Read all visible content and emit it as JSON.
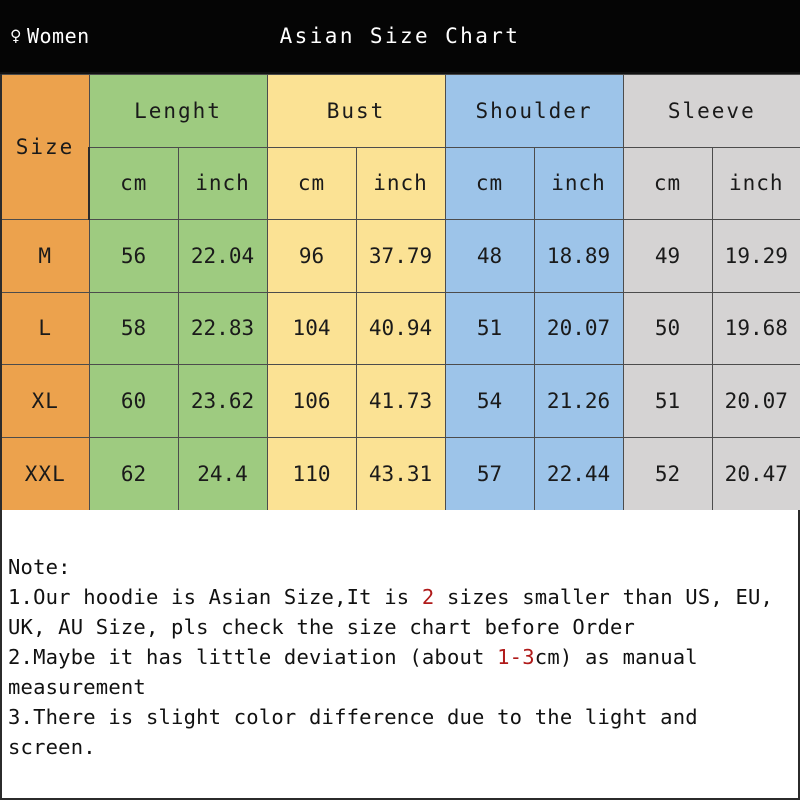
{
  "header": {
    "gender_icon": "venus-icon",
    "gender_symbol": "♀",
    "gender_label": "Women",
    "title": "Asian Size Chart"
  },
  "table": {
    "size_header": "Size",
    "groups": [
      {
        "label": "Lenght",
        "color": "#9ECB80"
      },
      {
        "label": "Bust",
        "color": "#FBE294"
      },
      {
        "label": "Shoulder",
        "color": "#9DC4E9"
      },
      {
        "label": "Sleeve",
        "color": "#D5D3D3"
      }
    ],
    "subheaders": {
      "cm": "cm",
      "inch": "inch"
    },
    "rows": [
      {
        "size": "M",
        "length_cm": "56",
        "length_inch": "22.04",
        "bust_cm": "96",
        "bust_inch": "37.79",
        "shoulder_cm": "48",
        "shoulder_inch": "18.89",
        "sleeve_cm": "49",
        "sleeve_inch": "19.29"
      },
      {
        "size": "L",
        "length_cm": "58",
        "length_inch": "22.83",
        "bust_cm": "104",
        "bust_inch": "40.94",
        "shoulder_cm": "51",
        "shoulder_inch": "20.07",
        "sleeve_cm": "50",
        "sleeve_inch": "19.68"
      },
      {
        "size": "XL",
        "length_cm": "60",
        "length_inch": "23.62",
        "bust_cm": "106",
        "bust_inch": "41.73",
        "shoulder_cm": "54",
        "shoulder_inch": "21.26",
        "sleeve_cm": "51",
        "sleeve_inch": "20.07"
      },
      {
        "size": "XXL",
        "length_cm": "62",
        "length_inch": "24.4",
        "bust_cm": "110",
        "bust_inch": "43.31",
        "shoulder_cm": "57",
        "shoulder_inch": "22.44",
        "sleeve_cm": "52",
        "sleeve_inch": "20.47"
      }
    ]
  },
  "notes": {
    "heading": "Note:",
    "line1_a": "1.Our hoodie is Asian Size,It is ",
    "line1_hl": "2",
    "line1_b": " sizes smaller than US, EU,",
    "line2": "UK, AU Size, pls check the size chart before Order",
    "line3_a": "2.Maybe it has little deviation (about ",
    "line3_hl": "1-3",
    "line3_b": "cm) as manual",
    "line4": "measurement",
    "line5": "3.There is slight color difference due to the light and screen."
  },
  "colors": {
    "size_column": "#ECA24D",
    "length_column": "#9ECB80",
    "bust_column": "#FBE294",
    "shoulder_column": "#9DC4E9",
    "sleeve_column": "#D5D3D3",
    "group_header_text": "#B5682E",
    "highlight_text": "#B01A1A",
    "header_background": "#050505"
  }
}
